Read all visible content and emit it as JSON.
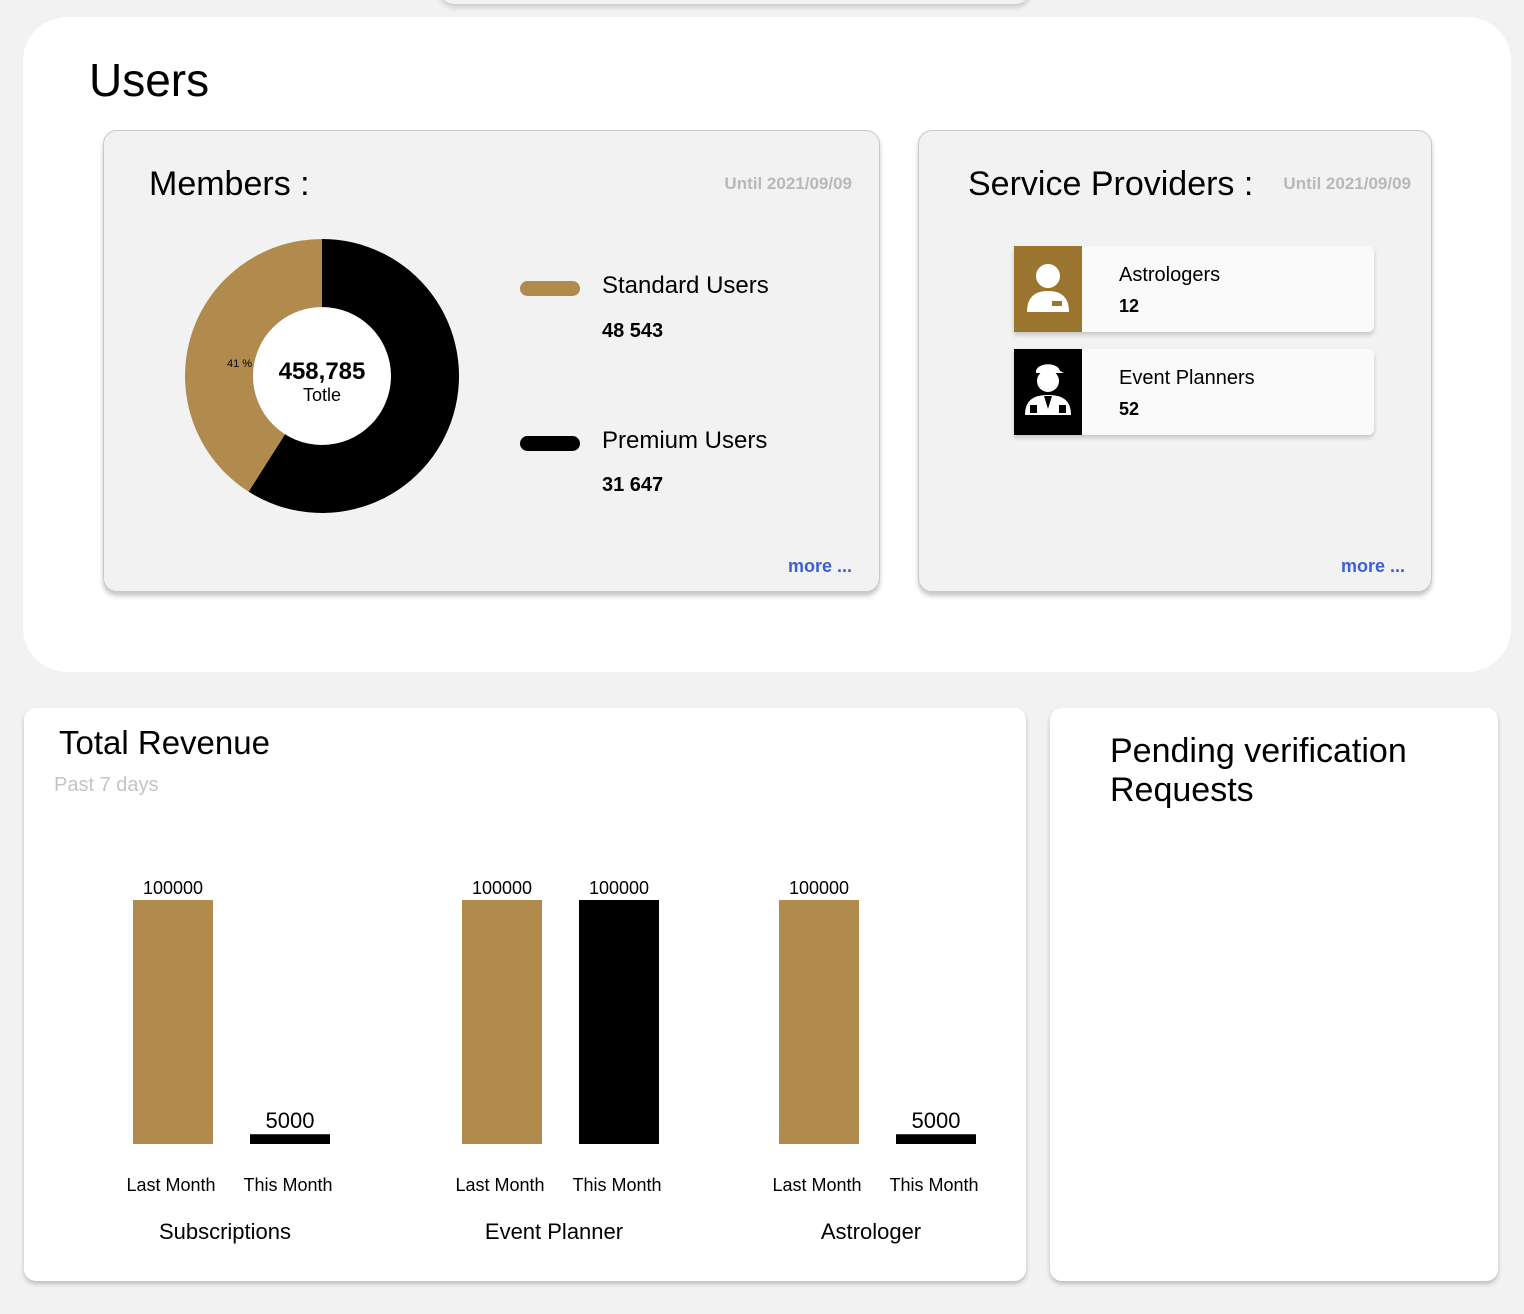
{
  "users": {
    "title": "Users",
    "members": {
      "title": "Members  :",
      "until": "Until 2021/09/09",
      "total_value": "458,785",
      "total_label": "Totle",
      "slice_label": "41 %",
      "standard": {
        "label": "Standard Users",
        "value": "48 543",
        "color": "#b18a4d"
      },
      "premium": {
        "label": "Premium Users",
        "value": "31 647",
        "color": "#000000"
      },
      "more": "more ..."
    },
    "providers": {
      "title": "Service Providers  :",
      "until": "Until 2021/09/09",
      "items": [
        {
          "label": "Astrologers",
          "count": "12",
          "icon_bg": "#9a7530"
        },
        {
          "label": "Event Planners",
          "count": "52",
          "icon_bg": "#000000"
        }
      ],
      "more": "more ..."
    }
  },
  "revenue": {
    "title": "Total Revenue",
    "subtitle": "Past 7 days"
  },
  "pending": {
    "title": "Pending verification Requests"
  },
  "colors": {
    "gold": "#b18a4d",
    "black": "#000000",
    "link": "#3b5fd6"
  },
  "chart_data": [
    {
      "type": "pie",
      "labels": [
        "Standard Users",
        "Premium Users"
      ],
      "values": [
        41,
        59
      ],
      "slice_labels": [
        "41 %",
        ""
      ],
      "colors": [
        "#b18a4d",
        "#000000"
      ]
    },
    {
      "type": "bar",
      "title": "Total Revenue",
      "groups": [
        {
          "name": "Subscriptions",
          "bars": [
            {
              "label": "Last Month",
              "value": 100000,
              "value_label": "100000"
            },
            {
              "label": "This Month",
              "value": 5000,
              "value_label": "5000"
            }
          ]
        },
        {
          "name": "Event Planner",
          "bars": [
            {
              "label": "Last Month",
              "value": 100000,
              "value_label": "100000"
            },
            {
              "label": "This Month",
              "value": 100000,
              "value_label": "100000"
            }
          ]
        },
        {
          "name": "Astrologer",
          "bars": [
            {
              "label": "Last Month",
              "value": 100000,
              "value_label": "100000"
            },
            {
              "label": "This Month",
              "value": 5000,
              "value_label": "5000"
            }
          ]
        }
      ],
      "colors": [
        "#b18a4d",
        "#000000"
      ]
    }
  ]
}
